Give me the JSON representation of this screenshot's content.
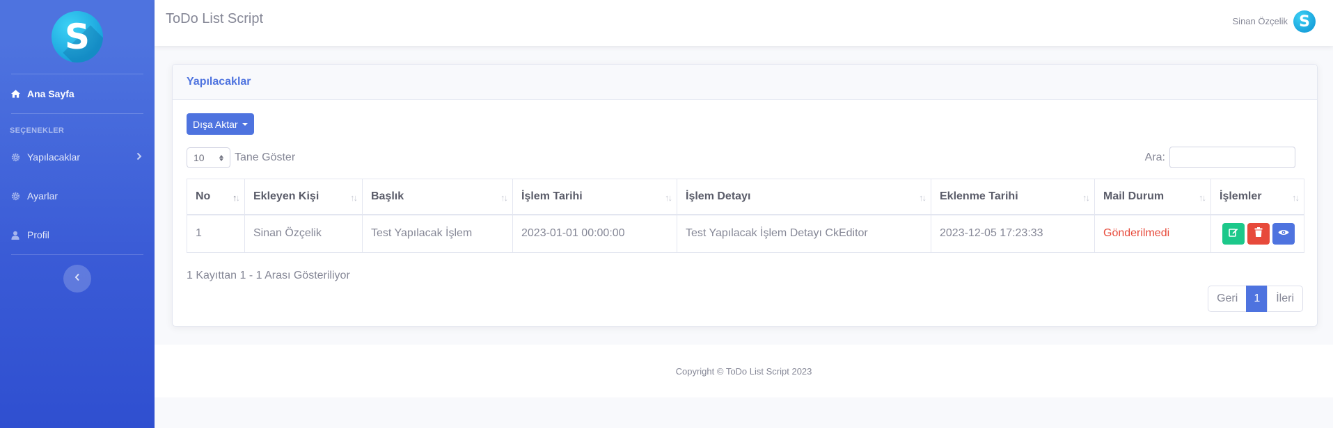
{
  "sidebar": {
    "logo_letter": "S",
    "home_label": "Ana Sayfa",
    "heading": "SEÇENEKLER",
    "items": [
      {
        "label": "Yapılacaklar",
        "icon": "gear-icon"
      },
      {
        "label": "Ayarlar",
        "icon": "gear-icon"
      },
      {
        "label": "Profil",
        "icon": "user-icon"
      }
    ]
  },
  "topbar": {
    "title": "ToDo List Script",
    "user_name": "Sinan Özçelik",
    "avatar_letter": "S"
  },
  "card": {
    "title": "Yapılacaklar",
    "export_label": "Dışa Aktar",
    "length_value": "10",
    "length_label": "Tane Göster",
    "search_label": "Ara:",
    "columns": [
      "No",
      "Ekleyen Kişi",
      "Başlık",
      "İşlem Tarihi",
      "İşlem Detayı",
      "Eklenme Tarihi",
      "Mail Durum",
      "İşlemler"
    ],
    "rows": [
      {
        "no": "1",
        "added_by": "Sinan Özçelik",
        "title": "Test Yapılacak İşlem",
        "process_date": "2023-01-01 00:00:00",
        "detail": "Test Yapılacak İşlem Detayı CkEditor",
        "created": "2023-12-05 17:23:33",
        "mail_status": "Gönderilmedi"
      }
    ],
    "info": "1 Kayıttan 1 - 1 Arası Gösteriliyor",
    "pagination": {
      "prev": "Geri",
      "current": "1",
      "next": "İleri"
    }
  },
  "footer": {
    "text": "Copyright © ToDo List Script 2023"
  },
  "colors": {
    "primary": "#4e73df",
    "success": "#1cc88a",
    "danger": "#e74a3b"
  }
}
